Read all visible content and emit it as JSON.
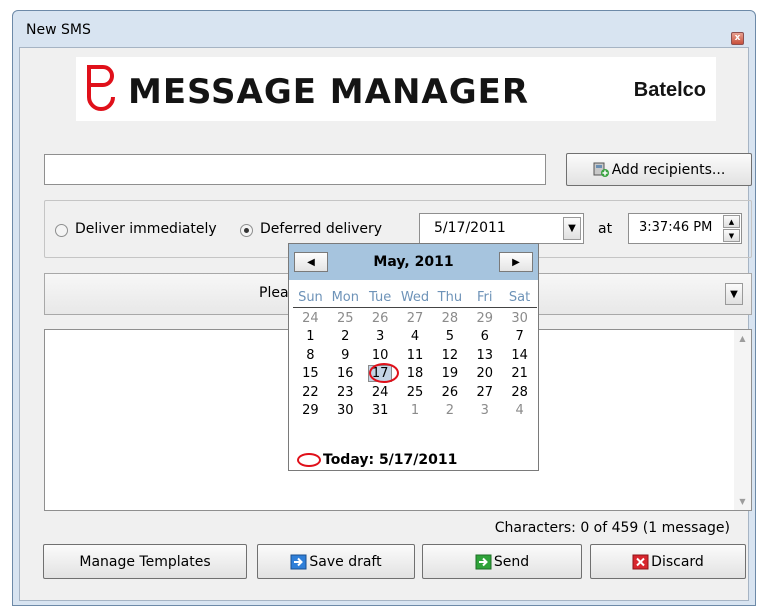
{
  "window": {
    "title": "New SMS",
    "close_glyph": "x"
  },
  "banner": {
    "app_name": "MESSAGE MANAGER",
    "brand": "Batelco"
  },
  "recipients": {
    "value": "",
    "add_button": "Add recipients..."
  },
  "delivery": {
    "immediate_label": "Deliver immediately",
    "deferred_label": "Deferred delivery",
    "selected": "deferred",
    "date": "5/17/2011",
    "at_label": "at",
    "time": "3:37:46 PM"
  },
  "template": {
    "value": "Pleas"
  },
  "message": {
    "text": "",
    "char_count": "Characters: 0 of 459 (1 message)"
  },
  "buttons": {
    "manage_templates": "Manage Templates",
    "save_draft": "Save draft",
    "send": "Send",
    "discard": "Discard"
  },
  "calendar": {
    "month_label": "May, 2011",
    "days_of_week": [
      "Sun",
      "Mon",
      "Tue",
      "Wed",
      "Thu",
      "Fri",
      "Sat"
    ],
    "weeks": [
      [
        "24",
        "25",
        "26",
        "27",
        "28",
        "29",
        "30"
      ],
      [
        "1",
        "2",
        "3",
        "4",
        "5",
        "6",
        "7"
      ],
      [
        "8",
        "9",
        "10",
        "11",
        "12",
        "13",
        "14"
      ],
      [
        "15",
        "16",
        "17",
        "18",
        "19",
        "20",
        "21"
      ],
      [
        "22",
        "23",
        "24",
        "25",
        "26",
        "27",
        "28"
      ],
      [
        "29",
        "30",
        "31",
        "1",
        "2",
        "3",
        "4"
      ]
    ],
    "selected_day": "17",
    "today_label": "Today: 5/17/2011"
  },
  "colors": {
    "accent_red": "#e0101a",
    "calendar_header": "#a6c4de",
    "window_frame": "#d8e4f1"
  },
  "icons": [
    "close-icon",
    "logo-icon",
    "add-recipients-icon",
    "save-draft-icon",
    "send-icon",
    "discard-icon",
    "chevron-down-icon",
    "chevron-left-icon",
    "chevron-right-icon"
  ]
}
